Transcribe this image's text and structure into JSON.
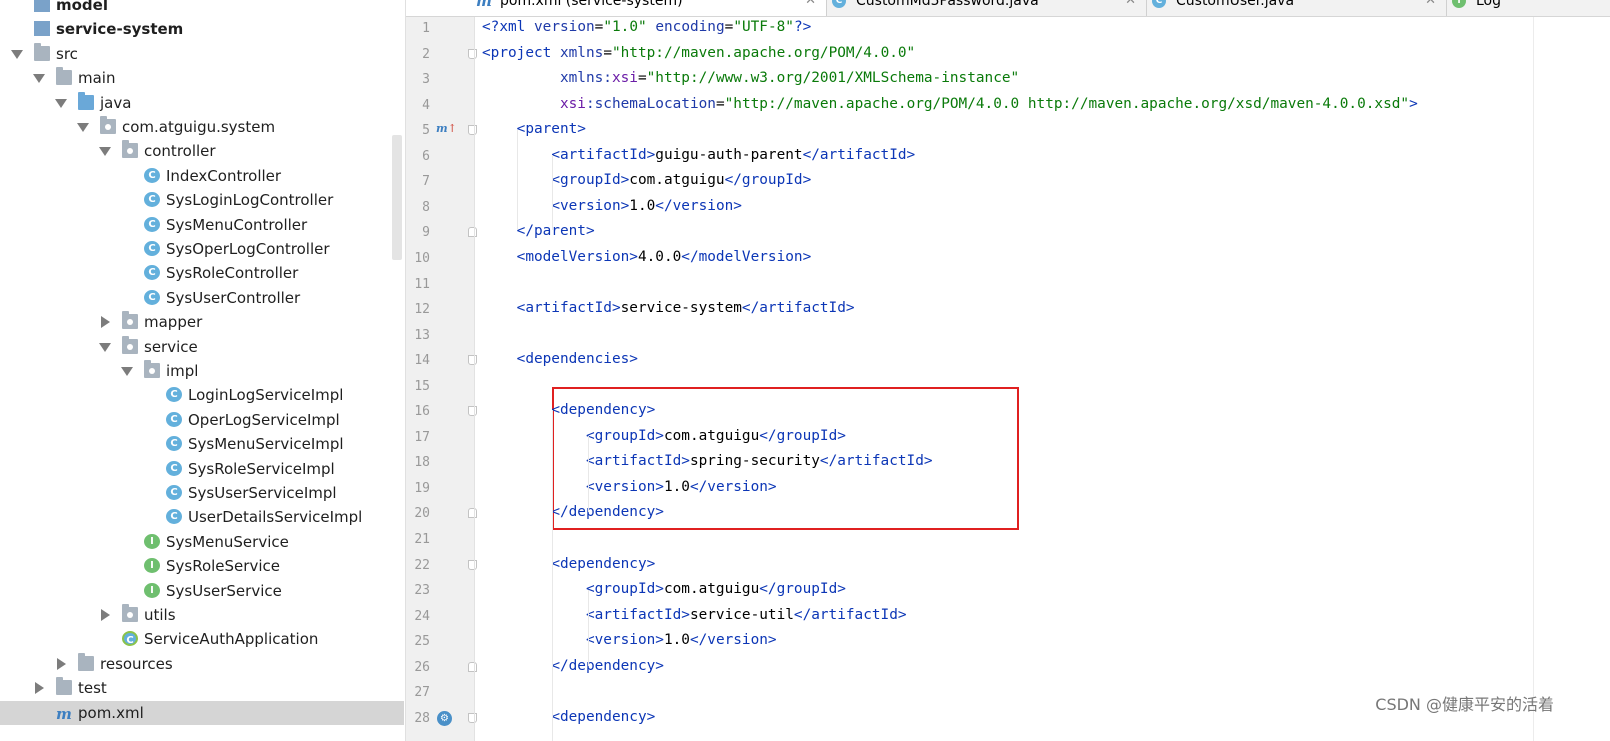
{
  "project_tree": {
    "rows": [
      {
        "label": "model",
        "icon": "module-icon",
        "depth": 0,
        "arrow": "none",
        "bold": true
      },
      {
        "label": "service-system",
        "icon": "module-icon",
        "depth": 0,
        "arrow": "none",
        "bold": true
      },
      {
        "label": "src",
        "icon": "folder-icon",
        "depth": 0,
        "arrow": "expanded"
      },
      {
        "label": "main",
        "icon": "folder-icon",
        "depth": 1,
        "arrow": "expanded"
      },
      {
        "label": "java",
        "icon": "source-folder-icon",
        "depth": 2,
        "arrow": "expanded"
      },
      {
        "label": "com.atguigu.system",
        "icon": "package-icon",
        "depth": 3,
        "arrow": "expanded"
      },
      {
        "label": "controller",
        "icon": "package-icon",
        "depth": 4,
        "arrow": "expanded"
      },
      {
        "label": "IndexController",
        "icon": "class-icon",
        "depth": 5,
        "arrow": "none"
      },
      {
        "label": "SysLoginLogController",
        "icon": "class-icon",
        "depth": 5,
        "arrow": "none"
      },
      {
        "label": "SysMenuController",
        "icon": "class-icon",
        "depth": 5,
        "arrow": "none"
      },
      {
        "label": "SysOperLogController",
        "icon": "class-icon",
        "depth": 5,
        "arrow": "none"
      },
      {
        "label": "SysRoleController",
        "icon": "class-icon",
        "depth": 5,
        "arrow": "none"
      },
      {
        "label": "SysUserController",
        "icon": "class-icon",
        "depth": 5,
        "arrow": "none"
      },
      {
        "label": "mapper",
        "icon": "package-icon",
        "depth": 4,
        "arrow": "collapsed"
      },
      {
        "label": "service",
        "icon": "package-icon",
        "depth": 4,
        "arrow": "expanded"
      },
      {
        "label": "impl",
        "icon": "package-icon",
        "depth": 5,
        "arrow": "expanded"
      },
      {
        "label": "LoginLogServiceImpl",
        "icon": "class-icon",
        "depth": 6,
        "arrow": "none"
      },
      {
        "label": "OperLogServiceImpl",
        "icon": "class-icon",
        "depth": 6,
        "arrow": "none"
      },
      {
        "label": "SysMenuServiceImpl",
        "icon": "class-icon",
        "depth": 6,
        "arrow": "none"
      },
      {
        "label": "SysRoleServiceImpl",
        "icon": "class-icon",
        "depth": 6,
        "arrow": "none"
      },
      {
        "label": "SysUserServiceImpl",
        "icon": "class-icon",
        "depth": 6,
        "arrow": "none"
      },
      {
        "label": "UserDetailsServiceImpl",
        "icon": "class-icon",
        "depth": 6,
        "arrow": "none"
      },
      {
        "label": "SysMenuService",
        "icon": "interface-icon",
        "depth": 5,
        "arrow": "none"
      },
      {
        "label": "SysRoleService",
        "icon": "interface-icon",
        "depth": 5,
        "arrow": "none"
      },
      {
        "label": "SysUserService",
        "icon": "interface-icon",
        "depth": 5,
        "arrow": "none"
      },
      {
        "label": "utils",
        "icon": "package-icon",
        "depth": 4,
        "arrow": "collapsed"
      },
      {
        "label": "ServiceAuthApplication",
        "icon": "spring-app-icon",
        "depth": 4,
        "arrow": "none"
      },
      {
        "label": "resources",
        "icon": "resources-folder-icon",
        "depth": 2,
        "arrow": "collapsed"
      },
      {
        "label": "test",
        "icon": "folder-icon",
        "depth": 1,
        "arrow": "collapsed"
      },
      {
        "label": "pom.xml",
        "icon": "maven-icon",
        "depth": 1,
        "arrow": "none",
        "selected": true
      }
    ]
  },
  "editor": {
    "tabs": [
      {
        "label": "pom.xml (service-system)",
        "icon": "maven-icon",
        "active": true
      },
      {
        "label": "CustomMd5Password.java",
        "icon": "class-icon",
        "active": false
      },
      {
        "label": "CustomUser.java",
        "icon": "class-icon",
        "active": false
      },
      {
        "label": "Log",
        "icon": "interface-icon",
        "active": false
      }
    ],
    "lines": [
      {
        "n": "1",
        "indent": 0,
        "html": "<span class='tag'>&lt;?</span><span class='tag'>xml</span> <span class='attr'>version</span>=<span class='str'>\"1.0\"</span> <span class='attr'>encoding</span>=<span class='str'>\"UTF-8\"</span><span class='tag'>?&gt;</span>"
      },
      {
        "n": "2",
        "indent": 0,
        "html": "<span class='tag'>&lt;project</span> <span class='attr'>xmlns</span>=<span class='str'>\"http://maven.apache.org/POM/4.0.0\"</span>"
      },
      {
        "n": "3",
        "indent": 0,
        "html": "         <span class='attr'>xmlns:</span><span class='ns'>xsi</span>=<span class='str'>\"http://www.w3.org/2001/XMLSchema-instance\"</span>"
      },
      {
        "n": "4",
        "indent": 0,
        "html": "         <span class='ns'>xsi</span><span class='attr'>:schemaLocation</span>=<span class='str'>\"http://maven.apache.org/POM/4.0.0 http://maven.apache.org/xsd/maven-4.0.0.xsd\"</span><span class='tag'>&gt;</span>"
      },
      {
        "n": "5",
        "indent": 0,
        "html": "    <span class='tag'>&lt;parent&gt;</span>"
      },
      {
        "n": "6",
        "indent": 0,
        "html": "        <span class='tag'>&lt;artifactId&gt;</span>guigu-auth-parent<span class='tag'>&lt;/artifactId&gt;</span>"
      },
      {
        "n": "7",
        "indent": 0,
        "html": "        <span class='tag'>&lt;groupId&gt;</span>com.atguigu<span class='tag'>&lt;/groupId&gt;</span>"
      },
      {
        "n": "8",
        "indent": 0,
        "html": "        <span class='tag'>&lt;version&gt;</span>1.0<span class='tag'>&lt;/version&gt;</span>"
      },
      {
        "n": "9",
        "indent": 0,
        "html": "    <span class='tag'>&lt;/parent&gt;</span>"
      },
      {
        "n": "10",
        "indent": 0,
        "html": "    <span class='tag'>&lt;modelVersion&gt;</span>4.0.0<span class='tag'>&lt;/modelVersion&gt;</span>"
      },
      {
        "n": "11",
        "indent": 0,
        "html": ""
      },
      {
        "n": "12",
        "indent": 0,
        "html": "    <span class='tag'>&lt;artifactId&gt;</span>service-system<span class='tag'>&lt;/artifactId&gt;</span>"
      },
      {
        "n": "13",
        "indent": 0,
        "html": ""
      },
      {
        "n": "14",
        "indent": 0,
        "html": "    <span class='tag'>&lt;dependencies&gt;</span>"
      },
      {
        "n": "15",
        "indent": 0,
        "html": ""
      },
      {
        "n": "16",
        "indent": 0,
        "html": "        <span class='tag'>&lt;dependency&gt;</span>"
      },
      {
        "n": "17",
        "indent": 0,
        "html": "            <span class='tag'>&lt;groupId&gt;</span>com.atguigu<span class='tag'>&lt;/groupId&gt;</span>"
      },
      {
        "n": "18",
        "indent": 0,
        "html": "            <span class='tag'>&lt;artifactId&gt;</span>spring-security<span class='tag'>&lt;/artifactId&gt;</span>"
      },
      {
        "n": "19",
        "indent": 0,
        "html": "            <span class='tag'>&lt;version&gt;</span>1.0<span class='tag'>&lt;/version&gt;</span>"
      },
      {
        "n": "20",
        "indent": 0,
        "html": "        <span class='tag'>&lt;/dependency&gt;</span>"
      },
      {
        "n": "21",
        "indent": 0,
        "html": ""
      },
      {
        "n": "22",
        "indent": 0,
        "html": "        <span class='tag'>&lt;dependency&gt;</span>"
      },
      {
        "n": "23",
        "indent": 0,
        "html": "            <span class='tag'>&lt;groupId&gt;</span>com.atguigu<span class='tag'>&lt;/groupId&gt;</span>"
      },
      {
        "n": "24",
        "indent": 0,
        "html": "            <span class='tag'>&lt;artifactId&gt;</span>service-util<span class='tag'>&lt;/artifactId&gt;</span>"
      },
      {
        "n": "25",
        "indent": 0,
        "html": "            <span class='tag'>&lt;version&gt;</span>1.0<span class='tag'>&lt;/version&gt;</span>"
      },
      {
        "n": "26",
        "indent": 0,
        "html": "        <span class='tag'>&lt;/dependency&gt;</span>"
      },
      {
        "n": "27",
        "indent": 0,
        "html": ""
      },
      {
        "n": "28",
        "indent": 0,
        "html": "        <span class='tag'>&lt;dependency&gt;</span>"
      }
    ],
    "gutter_markers": {
      "override_line": "5",
      "override_glyph": "m",
      "override_arrow": "↑",
      "badge_line": "28",
      "badge_glyph": "⚙"
    },
    "highlight_note": "lines 16-20"
  },
  "watermark": "CSDN @健康平安的活着",
  "colors": {
    "tag": "#0c36b6",
    "string": "#0a7a0a",
    "namespace": "#6b1da7",
    "highlight_box": "#e02020",
    "selection": "#d5d5d5"
  }
}
